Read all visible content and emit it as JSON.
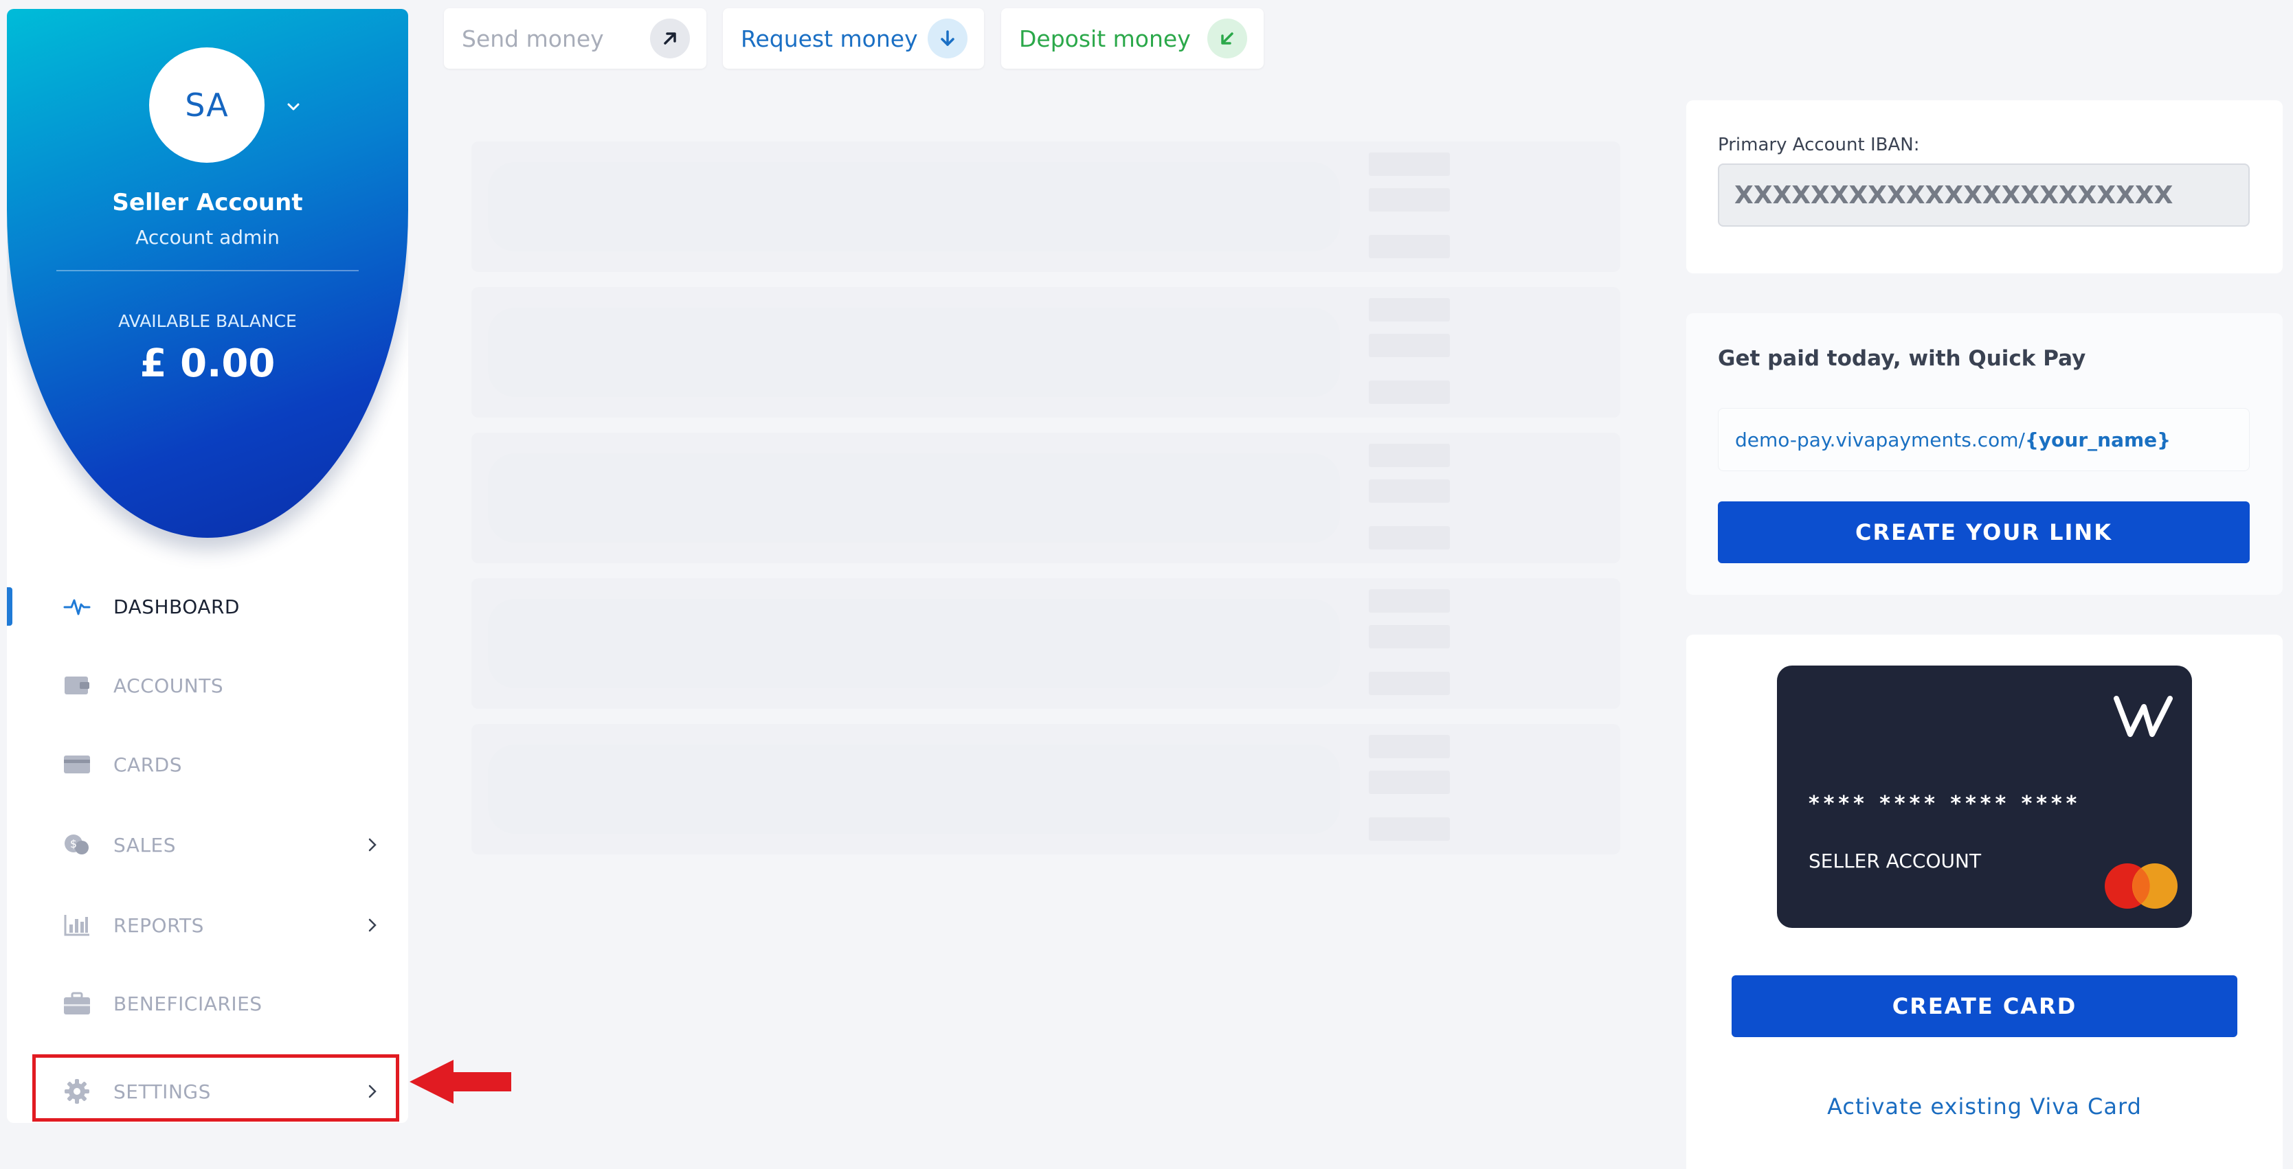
{
  "profile": {
    "initials": "SA",
    "name": "Seller Account",
    "role": "Account admin",
    "balance_label": "AVAILABLE BALANCE",
    "balance_value": "£ 0.00"
  },
  "nav": {
    "items": [
      {
        "label": "DASHBOARD",
        "icon": "pulse-icon",
        "active": true
      },
      {
        "label": "ACCOUNTS",
        "icon": "wallet-icon"
      },
      {
        "label": "CARDS",
        "icon": "card-icon"
      },
      {
        "label": "SALES",
        "icon": "coins-icon",
        "has_submenu": true
      },
      {
        "label": "REPORTS",
        "icon": "bar-chart-icon",
        "has_submenu": true
      },
      {
        "label": "BENEFICIARIES",
        "icon": "briefcase-icon"
      },
      {
        "label": "SETTINGS",
        "icon": "gear-icon",
        "has_submenu": true,
        "highlighted": true
      }
    ]
  },
  "actions": {
    "send": "Send money",
    "request": "Request money",
    "deposit": "Deposit money"
  },
  "iban": {
    "label": "Primary Account IBAN:",
    "value": "XXXXXXXXXXXXXXXXXXXXXXX"
  },
  "quickpay": {
    "title": "Get paid today, with Quick Pay",
    "link_prefix": "demo-pay.vivapayments.com/",
    "link_suffix": "{your_name}",
    "button": "CREATE YOUR LINK"
  },
  "card": {
    "number": "**** **** **** ****",
    "holder": "SELLER ACCOUNT",
    "create_button": "CREATE CARD",
    "activate_link": "Activate existing Viva Card"
  },
  "colors": {
    "primary": "#0c4fcf",
    "accent_blue": "#1a70c2",
    "green": "#2ba84a",
    "highlight_red": "#e11b22"
  }
}
